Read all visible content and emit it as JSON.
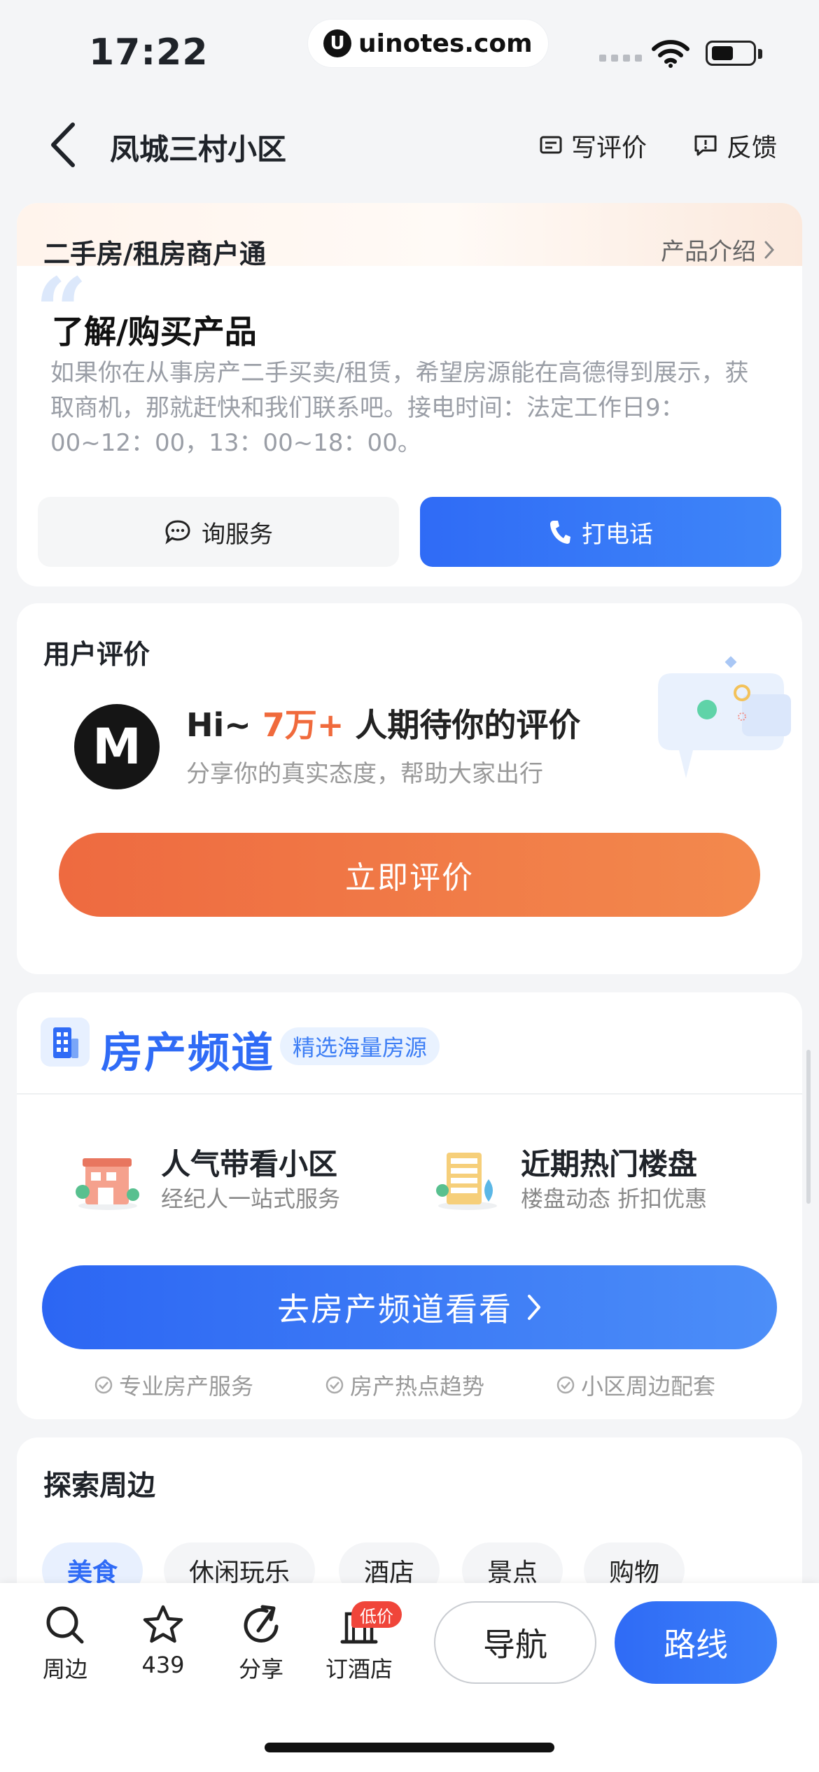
{
  "status_bar": {
    "time": "17:22",
    "site": "uinotes.com",
    "site_logo_letter": "U"
  },
  "header": {
    "title": "凤城三村小区",
    "write_review": "写评价",
    "feedback": "反馈"
  },
  "merchant": {
    "title": "二手房/租房商户通",
    "link": "产品介绍",
    "heading": "了解/购买产品",
    "description": "如果你在从事房产二手买卖/租赁，希望房源能在高德得到展示，获取商机，那就赶快和我们联系吧。接电时间：法定工作日9：00~12：00，13：00~18：00。",
    "consult_button": "询服务",
    "call_button": "打电话"
  },
  "review": {
    "title": "用户评价",
    "headline_prefix": "Hi~",
    "headline_count": "7万+",
    "headline_suffix": "人期待你的评价",
    "subtitle": "分享你的真实态度，帮助大家出行",
    "button": "立即评价"
  },
  "estate": {
    "title": "房产频道",
    "tag": "精选海量房源",
    "items": [
      {
        "title": "人气带看小区",
        "subtitle": "经纪人一站式服务"
      },
      {
        "title": "近期热门楼盘",
        "subtitle": "楼盘动态 折扣优惠"
      }
    ],
    "button": "去房产频道看看",
    "features": [
      "专业房产服务",
      "房产热点趋势",
      "小区周边配套"
    ]
  },
  "explore": {
    "title": "探索周边",
    "chips": [
      "美食",
      "休闲玩乐",
      "酒店",
      "景点",
      "购物"
    ],
    "active_chip": "美食"
  },
  "bottom_bar": {
    "tabs": [
      {
        "label": "周边",
        "icon": "search-icon"
      },
      {
        "label": "439",
        "icon": "star-icon"
      },
      {
        "label": "分享",
        "icon": "share-icon"
      },
      {
        "label": "订酒店",
        "icon": "hotel-icon"
      }
    ],
    "hotel_badge": "低价",
    "navigate_button": "导航",
    "route_button": "路线"
  },
  "colors": {
    "primary_blue": "#2f6bf6",
    "accent_orange": "#f06a3c"
  }
}
